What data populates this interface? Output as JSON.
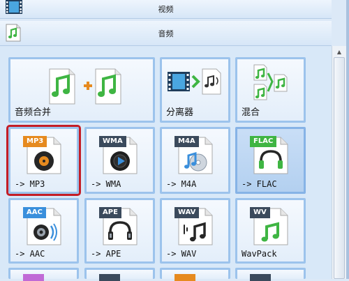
{
  "categories": {
    "video": {
      "label": "视频",
      "icon": "video-film-icon"
    },
    "audio": {
      "label": "音频",
      "icon": "audio-file-icon"
    }
  },
  "tiles": [
    {
      "id": "merge",
      "label": "音频合并",
      "icon": "audio-merge-icon"
    },
    {
      "id": "splitter",
      "label": "分离器",
      "icon": "splitter-icon"
    },
    {
      "id": "mix",
      "label": "混合",
      "icon": "mix-icon"
    },
    {
      "id": "mp3",
      "label": "-> MP3",
      "tag": "MP3",
      "tag_color": "#e68a1f",
      "icon": "mp3-disc-icon"
    },
    {
      "id": "wma",
      "label": "-> WMA",
      "tag": "WMA",
      "tag_color": "#3b4a5c",
      "icon": "wma-disc-icon"
    },
    {
      "id": "m4a",
      "label": "-> M4A",
      "tag": "M4A",
      "tag_color": "#3b4a5c",
      "icon": "m4a-cd-icon"
    },
    {
      "id": "flac",
      "label": "-> FLAC",
      "tag": "FLAC",
      "tag_color": "#3fb543",
      "icon": "flac-headphones-icon"
    },
    {
      "id": "aac",
      "label": "-> AAC",
      "tag": "AAC",
      "tag_color": "#3a8fdc",
      "icon": "aac-speaker-icon"
    },
    {
      "id": "ape",
      "label": "-> APE",
      "tag": "APE",
      "tag_color": "#3b4a5c",
      "icon": "ape-headphones-icon"
    },
    {
      "id": "wav",
      "label": "-> WAV",
      "tag": "WAV",
      "tag_color": "#3b4a5c",
      "icon": "wav-note-icon"
    },
    {
      "id": "wavpack",
      "label": "WavPack",
      "tag": "WV",
      "tag_color": "#3b4a5c",
      "icon": "wavpack-note-icon"
    }
  ],
  "colors": {
    "selection": "#c41d26",
    "accent": "#9cc3ec"
  }
}
